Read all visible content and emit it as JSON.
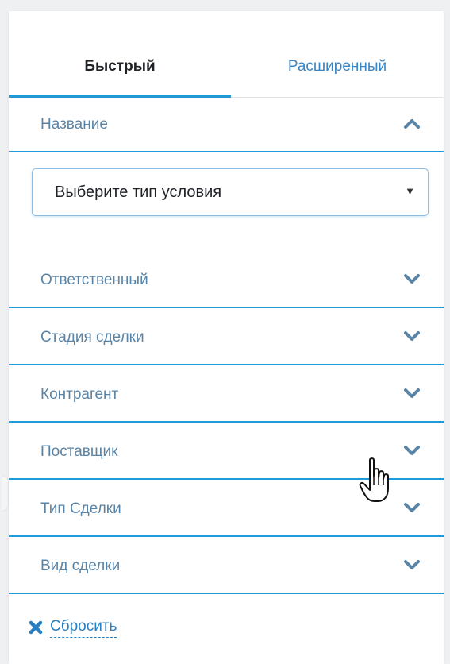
{
  "tabs": {
    "quick": "Быстрый",
    "extended": "Расширенный"
  },
  "filter": {
    "name_section": "Название",
    "condition_select": {
      "value": "Выберите тип условия"
    },
    "sections": [
      "Ответственный",
      "Стадия сделки",
      "Контрагент",
      "Поставщик",
      "Тип Сделки",
      "Вид сделки"
    ],
    "reset_label": "Сбросить"
  },
  "colors": {
    "accent": "#1e9ad6",
    "label": "#5a84a6",
    "link": "#2a7fc0"
  },
  "icons": {
    "expanded": "chevron-up-icon",
    "collapsed": "chevron-down-icon",
    "reset": "close-icon"
  }
}
